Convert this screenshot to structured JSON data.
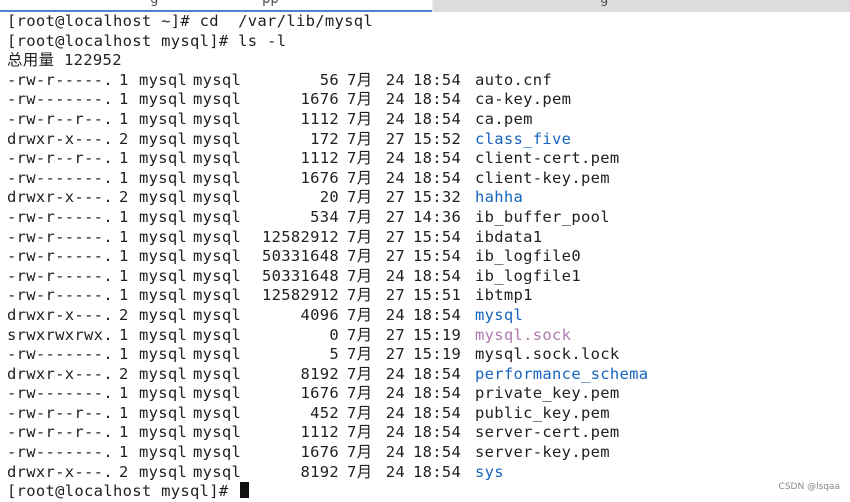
{
  "tabs": [
    {
      "label": "g"
    },
    {
      "label": "pp"
    },
    {
      "label": "g"
    }
  ],
  "terminal": {
    "lines": [
      {
        "kind": "cmd",
        "text": "[root@localhost ~]# cd  /var/lib/mysql"
      },
      {
        "kind": "cmd",
        "text": "[root@localhost mysql]# ls -l"
      },
      {
        "kind": "text",
        "text": "总用量 122952"
      },
      {
        "kind": "entry",
        "perm": "-rw-r-----.",
        "links": "1",
        "owner": "mysql",
        "group": "mysql",
        "size": "56",
        "month": "7月",
        "day": "24",
        "time": "18:54",
        "name": "auto.cnf",
        "type": "reg"
      },
      {
        "kind": "entry",
        "perm": "-rw-------.",
        "links": "1",
        "owner": "mysql",
        "group": "mysql",
        "size": "1676",
        "month": "7月",
        "day": "24",
        "time": "18:54",
        "name": "ca-key.pem",
        "type": "reg"
      },
      {
        "kind": "entry",
        "perm": "-rw-r--r--.",
        "links": "1",
        "owner": "mysql",
        "group": "mysql",
        "size": "1112",
        "month": "7月",
        "day": "24",
        "time": "18:54",
        "name": "ca.pem",
        "type": "reg"
      },
      {
        "kind": "entry",
        "perm": "drwxr-x---.",
        "links": "2",
        "owner": "mysql",
        "group": "mysql",
        "size": "172",
        "month": "7月",
        "day": "27",
        "time": "15:52",
        "name": "class_five",
        "type": "dir"
      },
      {
        "kind": "entry",
        "perm": "-rw-r--r--.",
        "links": "1",
        "owner": "mysql",
        "group": "mysql",
        "size": "1112",
        "month": "7月",
        "day": "24",
        "time": "18:54",
        "name": "client-cert.pem",
        "type": "reg"
      },
      {
        "kind": "entry",
        "perm": "-rw-------.",
        "links": "1",
        "owner": "mysql",
        "group": "mysql",
        "size": "1676",
        "month": "7月",
        "day": "24",
        "time": "18:54",
        "name": "client-key.pem",
        "type": "reg"
      },
      {
        "kind": "entry",
        "perm": "drwxr-x---.",
        "links": "2",
        "owner": "mysql",
        "group": "mysql",
        "size": "20",
        "month": "7月",
        "day": "27",
        "time": "15:32",
        "name": "hahha",
        "type": "dir"
      },
      {
        "kind": "entry",
        "perm": "-rw-r-----.",
        "links": "1",
        "owner": "mysql",
        "group": "mysql",
        "size": "534",
        "month": "7月",
        "day": "27",
        "time": "14:36",
        "name": "ib_buffer_pool",
        "type": "reg"
      },
      {
        "kind": "entry",
        "perm": "-rw-r-----.",
        "links": "1",
        "owner": "mysql",
        "group": "mysql",
        "size": "12582912",
        "month": "7月",
        "day": "27",
        "time": "15:54",
        "name": "ibdata1",
        "type": "reg"
      },
      {
        "kind": "entry",
        "perm": "-rw-r-----.",
        "links": "1",
        "owner": "mysql",
        "group": "mysql",
        "size": "50331648",
        "month": "7月",
        "day": "27",
        "time": "15:54",
        "name": "ib_logfile0",
        "type": "reg"
      },
      {
        "kind": "entry",
        "perm": "-rw-r-----.",
        "links": "1",
        "owner": "mysql",
        "group": "mysql",
        "size": "50331648",
        "month": "7月",
        "day": "24",
        "time": "18:54",
        "name": "ib_logfile1",
        "type": "reg"
      },
      {
        "kind": "entry",
        "perm": "-rw-r-----.",
        "links": "1",
        "owner": "mysql",
        "group": "mysql",
        "size": "12582912",
        "month": "7月",
        "day": "27",
        "time": "15:51",
        "name": "ibtmp1",
        "type": "reg"
      },
      {
        "kind": "entry",
        "perm": "drwxr-x---.",
        "links": "2",
        "owner": "mysql",
        "group": "mysql",
        "size": "4096",
        "month": "7月",
        "day": "24",
        "time": "18:54",
        "name": "mysql",
        "type": "dir"
      },
      {
        "kind": "entry",
        "perm": "srwxrwxrwx.",
        "links": "1",
        "owner": "mysql",
        "group": "mysql",
        "size": "0",
        "month": "7月",
        "day": "27",
        "time": "15:19",
        "name": "mysql.sock",
        "type": "sock"
      },
      {
        "kind": "entry",
        "perm": "-rw-------.",
        "links": "1",
        "owner": "mysql",
        "group": "mysql",
        "size": "5",
        "month": "7月",
        "day": "27",
        "time": "15:19",
        "name": "mysql.sock.lock",
        "type": "reg"
      },
      {
        "kind": "entry",
        "perm": "drwxr-x---.",
        "links": "2",
        "owner": "mysql",
        "group": "mysql",
        "size": "8192",
        "month": "7月",
        "day": "24",
        "time": "18:54",
        "name": "performance_schema",
        "type": "dir"
      },
      {
        "kind": "entry",
        "perm": "-rw-------.",
        "links": "1",
        "owner": "mysql",
        "group": "mysql",
        "size": "1676",
        "month": "7月",
        "day": "24",
        "time": "18:54",
        "name": "private_key.pem",
        "type": "reg"
      },
      {
        "kind": "entry",
        "perm": "-rw-r--r--.",
        "links": "1",
        "owner": "mysql",
        "group": "mysql",
        "size": "452",
        "month": "7月",
        "day": "24",
        "time": "18:54",
        "name": "public_key.pem",
        "type": "reg"
      },
      {
        "kind": "entry",
        "perm": "-rw-r--r--.",
        "links": "1",
        "owner": "mysql",
        "group": "mysql",
        "size": "1112",
        "month": "7月",
        "day": "24",
        "time": "18:54",
        "name": "server-cert.pem",
        "type": "reg"
      },
      {
        "kind": "entry",
        "perm": "-rw-------.",
        "links": "1",
        "owner": "mysql",
        "group": "mysql",
        "size": "1676",
        "month": "7月",
        "day": "24",
        "time": "18:54",
        "name": "server-key.pem",
        "type": "reg"
      },
      {
        "kind": "entry",
        "perm": "drwxr-x---.",
        "links": "2",
        "owner": "mysql",
        "group": "mysql",
        "size": "8192",
        "month": "7月",
        "day": "24",
        "time": "18:54",
        "name": "sys",
        "type": "dir"
      },
      {
        "kind": "prompt",
        "text": "[root@localhost mysql]# "
      }
    ]
  },
  "colors": {
    "directory": "#1565c0",
    "socket": "#b07bb0",
    "text": "#1f1f1f",
    "tab_accent": "#4a86c8"
  },
  "watermark": "CSDN @lsqaa"
}
